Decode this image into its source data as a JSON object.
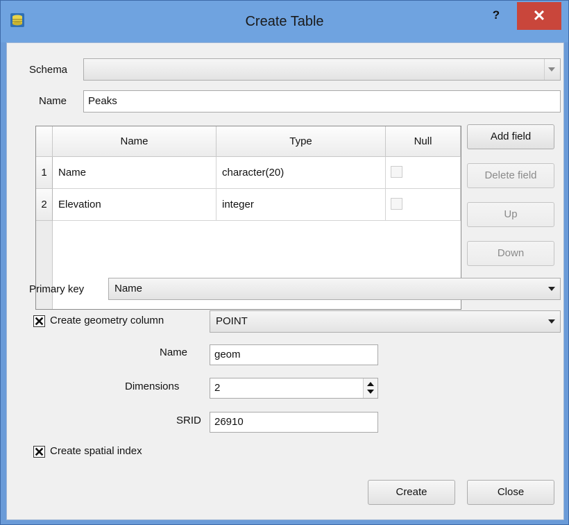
{
  "window": {
    "title": "Create Table",
    "help_glyph": "?",
    "close_glyph": "✕"
  },
  "schema": {
    "label": "Schema",
    "value": ""
  },
  "name": {
    "label": "Name",
    "value": "Peaks"
  },
  "fields_table": {
    "columns": [
      "Name",
      "Type",
      "Null"
    ],
    "rows": [
      {
        "index": "1",
        "name": "Name",
        "type": "character(20)",
        "null": false
      },
      {
        "index": "2",
        "name": "Elevation",
        "type": "integer",
        "null": false
      }
    ]
  },
  "field_buttons": {
    "add": "Add field",
    "delete": "Delete field",
    "up": "Up",
    "down": "Down"
  },
  "primary_key": {
    "label": "Primary key",
    "value": "Name"
  },
  "geometry": {
    "checkbox_label": "Create geometry column",
    "checked": true,
    "type_value": "POINT",
    "name_label": "Name",
    "name_value": "geom",
    "dimensions_label": "Dimensions",
    "dimensions_value": "2",
    "srid_label": "SRID",
    "srid_value": "26910"
  },
  "spatial_index": {
    "label": "Create spatial index",
    "checked": true
  },
  "footer": {
    "create": "Create",
    "close": "Close"
  },
  "colors": {
    "titlebar": "#6fa3e0",
    "close_button": "#c9463b",
    "dialog_bg": "#f0f0f0"
  }
}
